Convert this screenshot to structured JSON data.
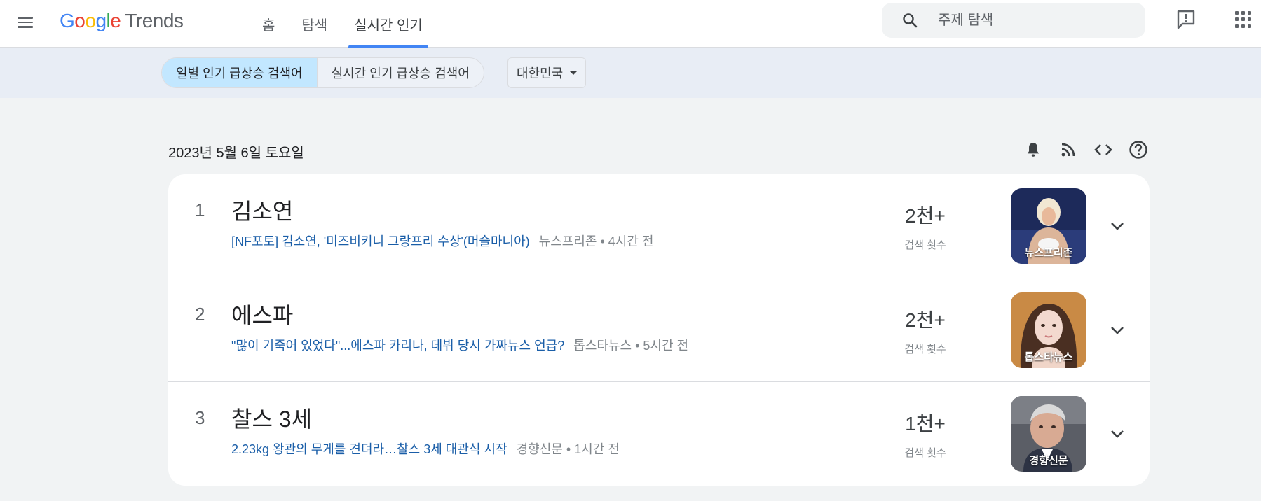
{
  "header": {
    "logo_google": [
      "G",
      "o",
      "o",
      "g",
      "l",
      "e"
    ],
    "logo_trends": "Trends",
    "nav": [
      {
        "label": "홈"
      },
      {
        "label": "탐색"
      },
      {
        "label": "실시간 인기"
      }
    ],
    "search": {
      "placeholder": "주제 탐색",
      "value": ""
    }
  },
  "filters": {
    "segments": [
      {
        "label": "일별 인기 급상승 검색어",
        "active": true
      },
      {
        "label": "실시간 인기 급상승 검색어",
        "active": false
      }
    ],
    "country": "대한민국"
  },
  "main": {
    "date": "2023년 5월 6일 토요일",
    "icons": [
      "bell-icon",
      "rss-icon",
      "code-icon",
      "help-icon"
    ],
    "trends": [
      {
        "rank": "1",
        "title": "김소연",
        "article_title": "[NF포토] 김소연, '미즈비키니 그랑프리 수상'(머슬마니아)",
        "article_meta": "뉴스프리존 • 4시간 전",
        "count": "2천+",
        "count_label": "검색 횟수",
        "image_source": "뉴스프리존"
      },
      {
        "rank": "2",
        "title": "에스파",
        "article_title": "\"많이 기죽어 있었다\"...에스파 카리나, 데뷔 당시 가짜뉴스 언급?",
        "article_meta": "톱스타뉴스 • 5시간 전",
        "count": "2천+",
        "count_label": "검색 횟수",
        "image_source": "톱스타뉴스"
      },
      {
        "rank": "3",
        "title": "찰스 3세",
        "article_title": "2.23kg 왕관의 무게를 견뎌라…찰스 3세 대관식 시작",
        "article_meta": "경향신문 • 1시간 전",
        "count": "1천+",
        "count_label": "검색 횟수",
        "image_source": "경향신문"
      }
    ]
  },
  "colors": {
    "accent": "#4285f4",
    "segment_active": "#c2e7ff",
    "link": "#1a5ea8",
    "subbar_bg": "#e8edf5"
  }
}
